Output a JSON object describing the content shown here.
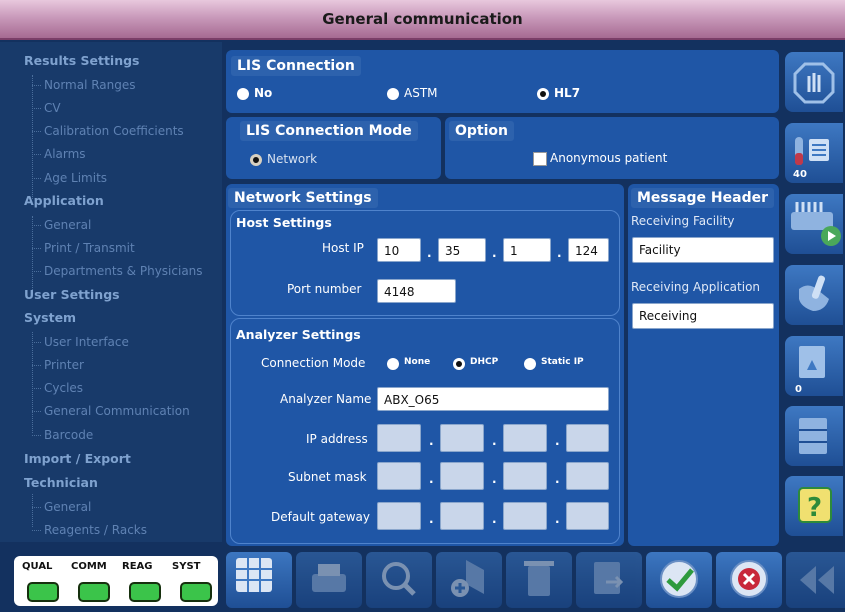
{
  "window": {
    "title": "General communication"
  },
  "sidebar": {
    "items": [
      {
        "label": "Results Settings",
        "level": 0
      },
      {
        "label": "Normal Ranges",
        "level": 1
      },
      {
        "label": "CV",
        "level": 1
      },
      {
        "label": "Calibration Coefficients",
        "level": 1
      },
      {
        "label": "Alarms",
        "level": 1
      },
      {
        "label": "Age Limits",
        "level": 1
      },
      {
        "label": "Application",
        "level": 0
      },
      {
        "label": "General",
        "level": 1
      },
      {
        "label": "Print / Transmit",
        "level": 1
      },
      {
        "label": "Departments & Physicians",
        "level": 1
      },
      {
        "label": "User Settings",
        "level": 0
      },
      {
        "label": "System",
        "level": 0
      },
      {
        "label": "User Interface",
        "level": 1
      },
      {
        "label": "Printer",
        "level": 1
      },
      {
        "label": "Cycles",
        "level": 1
      },
      {
        "label": "General Communication",
        "level": 1
      },
      {
        "label": "Barcode",
        "level": 1
      },
      {
        "label": "Import / Export",
        "level": 0
      },
      {
        "label": "Technician",
        "level": 0
      },
      {
        "label": "General",
        "level": 1
      },
      {
        "label": "Reagents / Racks",
        "level": 1
      }
    ]
  },
  "lis": {
    "title": "LIS Connection",
    "options": [
      {
        "label": "No",
        "selected": false
      },
      {
        "label": "ASTM",
        "selected": false
      },
      {
        "label": "HL7",
        "selected": true
      }
    ]
  },
  "mode": {
    "title": "LIS Connection Mode",
    "network_label": "Network"
  },
  "option": {
    "title": "Option",
    "anonymous_label": "Anonymous patient"
  },
  "network": {
    "title": "Network Settings",
    "host": {
      "title": "Host Settings",
      "ip_label": "Host IP",
      "ip": [
        "10",
        "35",
        "1",
        "124"
      ],
      "port_label": "Port number",
      "port": "4148"
    },
    "analyzer": {
      "title": "Analyzer Settings",
      "conn_mode_label": "Connection Mode",
      "conn_modes": [
        {
          "label": "None",
          "selected": false
        },
        {
          "label": "DHCP",
          "selected": true
        },
        {
          "label": "Static IP",
          "selected": false
        }
      ],
      "name_label": "Analyzer Name",
      "name": "ABX_O65",
      "ip_label": "IP address",
      "subnet_label": "Subnet mask",
      "gateway_label": "Default gateway"
    }
  },
  "message_header": {
    "title": "Message Header",
    "facility_label": "Receiving Facility",
    "facility": "Facility",
    "application_label": "Receiving Application",
    "application": "Receiving"
  },
  "right_toolbar": {
    "badge_tubes": "40",
    "badge_reports": "0"
  },
  "status": {
    "labels": [
      "QUAL",
      "COMM",
      "REAG",
      "SYST"
    ],
    "led_color": "#3bc44a"
  },
  "colors": {
    "panel": "#1f56a6",
    "background": "#13315f",
    "title_accent": "#c99abb"
  }
}
